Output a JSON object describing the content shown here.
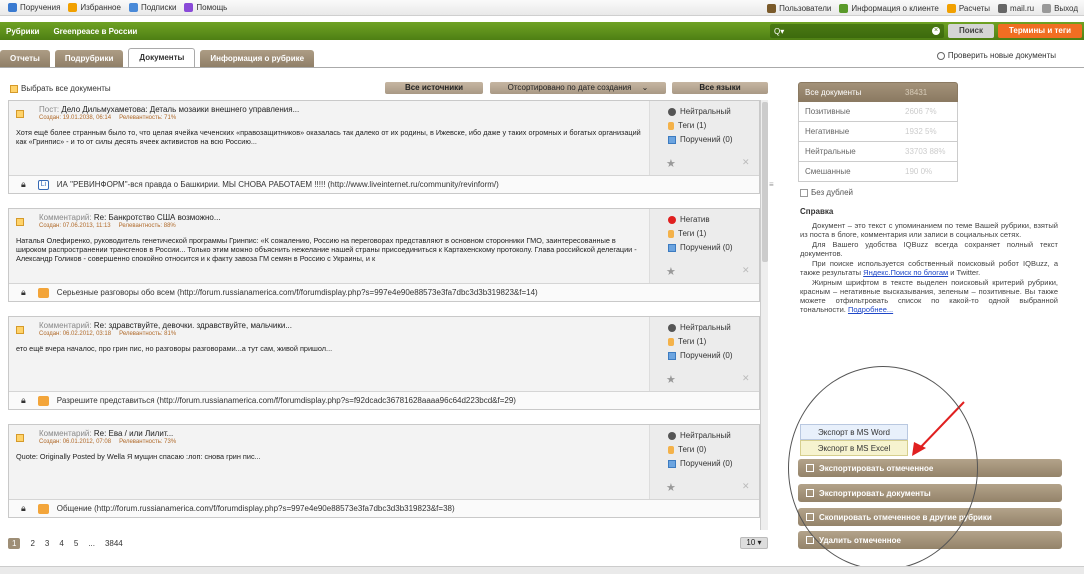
{
  "topbar": {
    "left": [
      {
        "label": "Поручения",
        "icon": "assignments-icon",
        "color": "#3a7ad0"
      },
      {
        "label": "Избранное",
        "icon": "star-icon",
        "color": "#f1a000"
      },
      {
        "label": "Подписки",
        "icon": "subscriptions-icon",
        "color": "#4a8ad8"
      },
      {
        "label": "Помощь",
        "icon": "help-icon",
        "color": "#8a4ad8"
      }
    ],
    "right": [
      {
        "label": "Пользователи",
        "icon": "users-icon",
        "color": "#7a5a2a"
      },
      {
        "label": "Информация о клиенте",
        "icon": "client-info-icon",
        "color": "#5a9a2a"
      },
      {
        "label": "Расчеты",
        "icon": "payments-icon",
        "color": "#f1a000"
      },
      {
        "label": "mail.ru",
        "icon": "user-icon",
        "color": "#666666"
      },
      {
        "label": "Выход",
        "icon": "exit-icon",
        "color": "#999999"
      }
    ]
  },
  "header": {
    "category": "Рубрики",
    "rubric": "Greenpeace в России",
    "search_label": "Q▾",
    "search_button": "Поиск",
    "terms_button": "Термины и теги"
  },
  "tabs": [
    "Отчеты",
    "Подрубрики",
    "Документы",
    "Информация о рубрике"
  ],
  "active_tab": 2,
  "check_new": "Проверить новые документы",
  "list": {
    "select_all": "Выбрать все документы",
    "filter_sources": "Все источники",
    "filter_sort": "Отсортировано по дате создания",
    "filter_langs": "Все языки"
  },
  "documents": [
    {
      "type": "Пост:",
      "title": "Дело Дильмухаметова: Деталь мозаики внешнего управления...",
      "created": "Создан: 19.01.2038, 06:14",
      "relevance": "Релевантность: 71%",
      "text": "Хотя ещё более странным было то, что целая ячейка чеченских «правозащитников» оказалась так далеко от их родины, в Ижевске, ибо даже у таких огромных и богатых организаций как «Гринпис» - и то от силы десять ячеек активистов на всю Россию...",
      "tone": "Нейтральный",
      "tone_color": "#555555",
      "tags": "Теги (1)",
      "assignments": "Поручений (0)",
      "source_type": "li",
      "source": "ИА \"РЕВИНФОРМ\"-вся правда о Башкирии. МЫ СНОВА РАБОТАЕМ !!!!! (http://www.liveinternet.ru/community/revinform/)"
    },
    {
      "type": "Комментарий:",
      "title": "Re: Банкротство США возможно...",
      "created": "Создан: 07.06.2013, 11:13",
      "relevance": "Релевантность: 88%",
      "text": "Наталья Олефиренко, руководитель генетической программы Гринпис: «К сожалению, Россию на переговорах представляют в основном сторонники ГМО, заинтересованные в широком распространении трансгенов в России... Только этим можно объяснить нежелание нашей страны присоединиться к Картахенскому протоколу. Глава российской делегации - Александр Голиков - совершенно спокойно относится и к факту завоза ГМ семян в Россию с Украины, и к",
      "tone": "Негатив",
      "tone_color": "#e02020",
      "tags": "Теги (1)",
      "assignments": "Поручений (0)",
      "source_type": "rss",
      "source": "Серьезные разговоры обо всем (http://forum.russianamerica.com/f/forumdisplay.php?s=997e4e90e88573e3fa7dbc3d3b319823&f=14)"
    },
    {
      "type": "Комментарий:",
      "title": "Re: здравствуйте, девочки. здравствуйте, мальчики...",
      "created": "Создан: 06.02.2012, 03:18",
      "relevance": "Релевантность: 81%",
      "text": "ето ещё вчера началос, про грин пис, но разговоры разговорами...а тут сам, живой пришол...",
      "tone": "Нейтральный",
      "tone_color": "#555555",
      "tags": "Теги (1)",
      "assignments": "Поручений (0)",
      "source_type": "rss",
      "source": "Разрешите представиться (http://forum.russianamerica.com/f/forumdisplay.php?s=f92dcadc36781628aaaa96c64d223bcd&f=29)"
    },
    {
      "type": "Комментарий:",
      "title": "Re: Ева / или Лилит...",
      "created": "Создан: 06.01.2012, 07:08",
      "relevance": "Релевантность: 73%",
      "text": "Quote: Originally Posted by Wella Я мущин спасаю :лоп: снова грин пис...",
      "tone": "Нейтральный",
      "tone_color": "#555555",
      "tags": "Теги (0)",
      "assignments": "Поручений (0)",
      "source_type": "rss",
      "source": "Общение (http://forum.russianamerica.com/f/forumdisplay.php?s=997e4e90e88573e3fa7dbc3d3b319823&f=38)"
    }
  ],
  "pager": {
    "pages": [
      "1",
      "2",
      "3",
      "4",
      "5",
      "...",
      "3844"
    ],
    "current": "1",
    "per_page": "10 ▾"
  },
  "stats": [
    {
      "label": "Все документы",
      "value": "38431"
    },
    {
      "label": "Позитивные",
      "value": "2606  7%"
    },
    {
      "label": "Негативные",
      "value": "1932  5%"
    },
    {
      "label": "Нейтральные",
      "value": "33703  88%"
    },
    {
      "label": "Смешанные",
      "value": "190  0%"
    }
  ],
  "no_duplicates": "Без дублей",
  "help": {
    "title": "Справка",
    "p1": "Документ – это текст с упоминанием по теме Вашей рубрики, взятый из поста в блоге, комментария или записи в социальных сетях.",
    "p2": "Для Вашего удобства IQBuzz всегда сохраняет полный текст документов.",
    "p3a": "При поиске используется собственный поисковый робот IQBuzz, а также результаты ",
    "p3link": "Яндекс.Поиск по блогам",
    "p3b": " и Twitter.",
    "p4a": "Жирным шрифтом в тексте выделен поисковый критерий рубрики, красным – негативные высказывания, зеленым – позитивные. Вы также можете отфильтровать список по какой-то одной выбранной тональности. ",
    "p4link": "Подробнее..."
  },
  "export_menu": [
    "Экспорт в MS Word",
    "Экспорт в MS Excel"
  ],
  "actions": [
    "Экспортировать отмеченное",
    "Экспортировать документы",
    "Скопировать отмеченное в другие рубрики",
    "Удалить отмеченное"
  ]
}
